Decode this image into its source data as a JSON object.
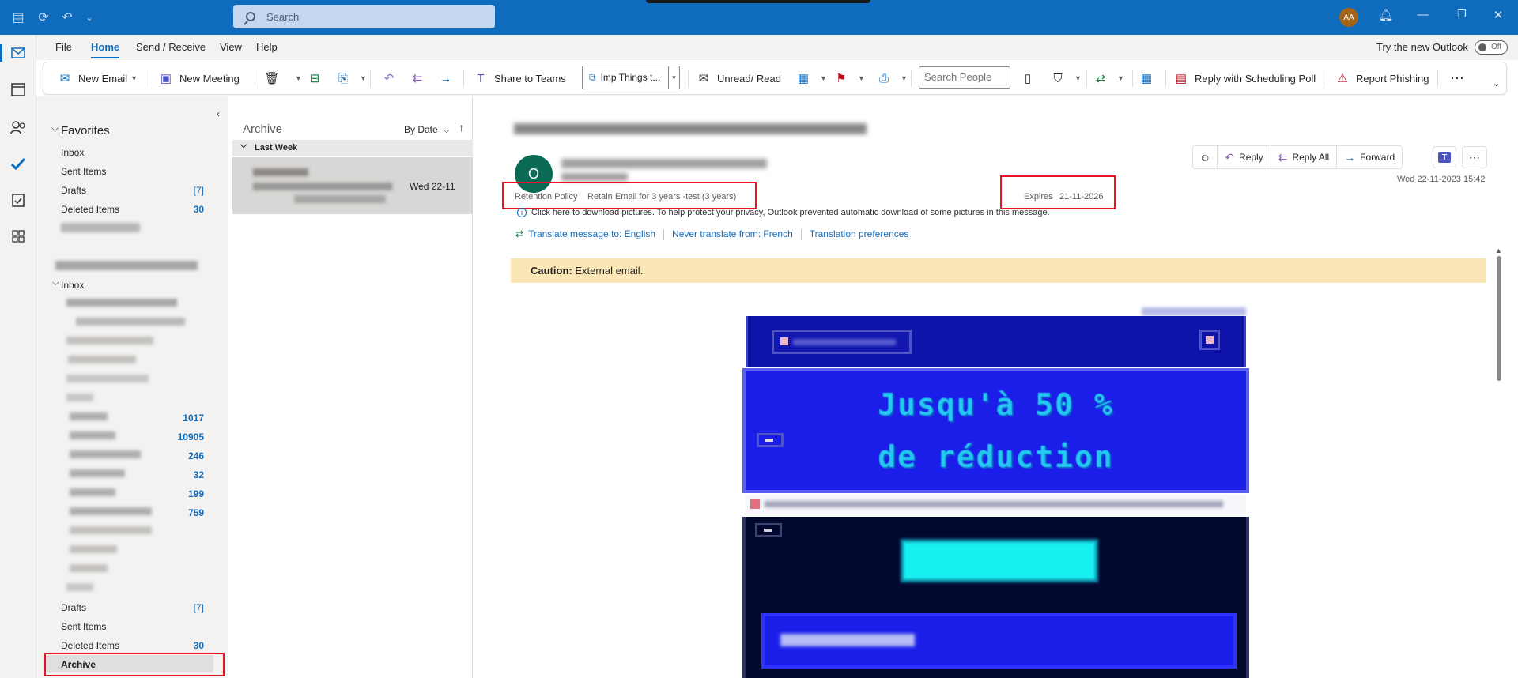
{
  "titlebar": {
    "search_placeholder": "Search",
    "user_initials": "AA"
  },
  "menu": {
    "tabs": [
      "File",
      "Home",
      "Send / Receive",
      "View",
      "Help"
    ],
    "active_tab": "Home",
    "try_new_outlook": "Try the new Outlook",
    "toggle_state": "Off"
  },
  "ribbon": {
    "new_email": "New Email",
    "new_meeting": "New Meeting",
    "share_to_teams": "Share to Teams",
    "quick_step": "Imp Things t...",
    "unread_read": "Unread/ Read",
    "search_people_placeholder": "Search People",
    "reply_scheduling_poll": "Reply with Scheduling Poll",
    "report_phishing": "Report Phishing"
  },
  "folders": {
    "favorites_header": "Favorites",
    "favorites": [
      {
        "label": "Inbox",
        "count": ""
      },
      {
        "label": "Sent Items",
        "count": ""
      },
      {
        "label": "Drafts",
        "count": "[7]"
      },
      {
        "label": "Deleted Items",
        "count": "30"
      }
    ],
    "inbox_label": "Inbox",
    "inbox_counts": [
      "1017",
      "10905",
      "246",
      "32",
      "199",
      "759"
    ],
    "bottom": [
      {
        "label": "Drafts",
        "count": "[7]"
      },
      {
        "label": "Sent Items",
        "count": ""
      },
      {
        "label": "Deleted Items",
        "count": "30"
      },
      {
        "label": "Archive",
        "count": ""
      }
    ]
  },
  "message_list": {
    "title": "Archive",
    "sort_label": "By Date",
    "group_header": "Last Week",
    "items": [
      {
        "date": "Wed 22-11"
      }
    ]
  },
  "reading": {
    "sender_initial": "O",
    "retention_label": "Retention Policy",
    "retention_value": "Retain Email for 3 years -test (3 years)",
    "expires_label": "Expires",
    "expires_value": "21-11-2026",
    "info_text": "Click here to download pictures. To help protect your privacy, Outlook prevented automatic download of some pictures in this message.",
    "translate_to": "Translate message to: English",
    "never_translate": "Never translate from: French",
    "translation_prefs": "Translation preferences",
    "caution_bold": "Caution:",
    "caution_text": " External email.",
    "actions": {
      "reply": "Reply",
      "reply_all": "Reply All",
      "forward": "Forward"
    },
    "datetime": "Wed 22-11-2023 15:42",
    "hero_line1": "Jusqu'à 50 %",
    "hero_line2": "de réduction"
  }
}
